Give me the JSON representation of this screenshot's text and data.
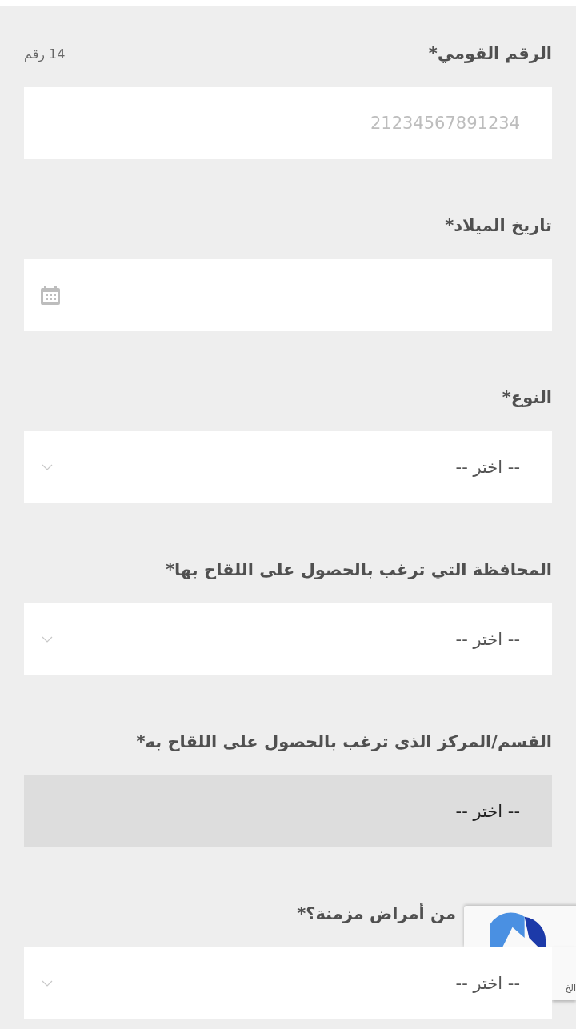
{
  "fields": [
    {
      "kind": "text",
      "label": "الرقم القومي*",
      "hint": "14 رقم",
      "placeholder": "21234567891234"
    },
    {
      "kind": "date",
      "label": "تاريخ الميلاد*"
    },
    {
      "kind": "select",
      "label": "النوع*",
      "value": "-- اختر --",
      "disabled": false
    },
    {
      "kind": "select",
      "label": "المحافظة التي ترغب بالحصول على اللقاح بها*",
      "value": "-- اختر --",
      "disabled": false
    },
    {
      "kind": "select",
      "label": "القسم/المركز الذى ترغب بالحصول على اللقاح به*",
      "value": "-- اختر --",
      "disabled": true
    },
    {
      "kind": "select",
      "label": "من أمراض مزمنة؟*",
      "value": "-- اختر --",
      "disabled": false,
      "obscured": true
    }
  ],
  "captcha_badge": {
    "text": "الخ"
  }
}
